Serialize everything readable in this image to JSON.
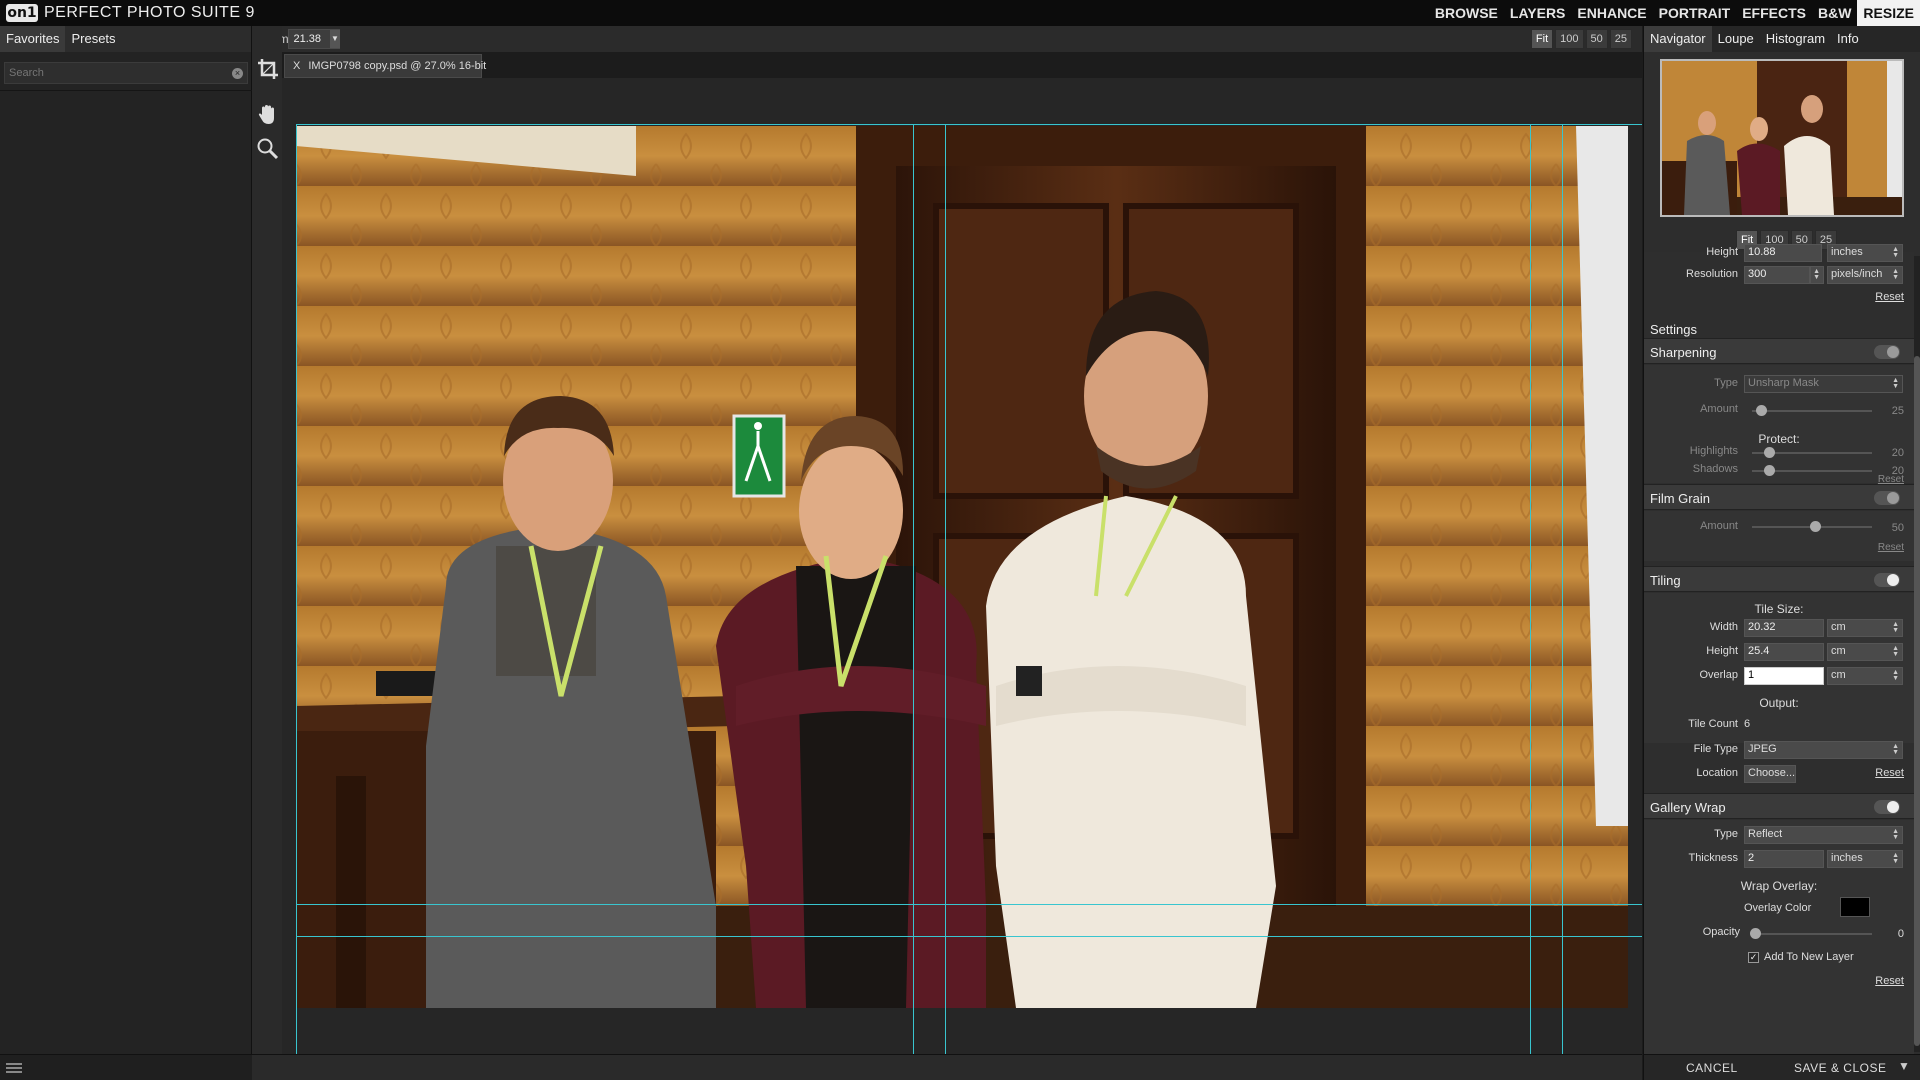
{
  "app": {
    "logo": "on1",
    "title": "PERFECT PHOTO SUITE 9"
  },
  "modules": [
    {
      "label": "BROWSE",
      "active": false
    },
    {
      "label": "LAYERS",
      "active": false
    },
    {
      "label": "ENHANCE",
      "active": false
    },
    {
      "label": "PORTRAIT",
      "active": false
    },
    {
      "label": "EFFECTS",
      "active": false
    },
    {
      "label": "B&W",
      "active": false
    },
    {
      "label": "RESIZE",
      "active": true
    }
  ],
  "left": {
    "tabs": [
      "Favorites",
      "Presets"
    ],
    "search_placeholder": "Search"
  },
  "zoom": {
    "label": "Zoom",
    "value": "21.38",
    "buttons": [
      "Fit",
      "100",
      "50",
      "25"
    ]
  },
  "file_tab": {
    "close": "X",
    "name": "IMGP0798 copy.psd @ 27.0% 16-bit"
  },
  "right": {
    "tabs": [
      "Navigator",
      "Loupe",
      "Histogram",
      "Info"
    ],
    "nav_buttons": [
      "Fit",
      "100",
      "50",
      "25"
    ],
    "height": {
      "label": "Height",
      "value": "10.88",
      "unit": "inches"
    },
    "resolution": {
      "label": "Resolution",
      "value": "300",
      "unit": "pixels/inch"
    },
    "reset": "Reset",
    "settings_label": "Settings",
    "sharpening": {
      "title": "Sharpening",
      "enabled": false,
      "type_label": "Type",
      "type_value": "Unsharp Mask",
      "amount_label": "Amount",
      "amount_value": "25",
      "protect_label": "Protect:",
      "highlights_label": "Highlights",
      "highlights_value": "20",
      "shadows_label": "Shadows",
      "shadows_value": "20"
    },
    "film_grain": {
      "title": "Film Grain",
      "enabled": false,
      "amount_label": "Amount",
      "amount_value": "50"
    },
    "tiling": {
      "title": "Tiling",
      "enabled": true,
      "tile_size_label": "Tile Size:",
      "width_label": "Width",
      "width_value": "20.32",
      "width_unit": "cm",
      "height_label": "Height",
      "height_value": "25.4",
      "height_unit": "cm",
      "overlap_label": "Overlap",
      "overlap_value": "1",
      "overlap_unit": "cm",
      "output_label": "Output:",
      "tile_count_label": "Tile Count",
      "tile_count_value": "6",
      "file_type_label": "File Type",
      "file_type_value": "JPEG",
      "location_label": "Location",
      "location_button": "Choose..."
    },
    "gallery_wrap": {
      "title": "Gallery Wrap",
      "enabled": true,
      "type_label": "Type",
      "type_value": "Reflect",
      "thickness_label": "Thickness",
      "thickness_value": "2",
      "thickness_unit": "inches",
      "wrap_overlay_label": "Wrap Overlay:",
      "overlay_color_label": "Overlay Color",
      "overlay_color": "#000000",
      "opacity_label": "Opacity",
      "opacity_value": "0",
      "add_layer_label": "Add To New Layer",
      "add_layer_checked": true
    },
    "cancel": "CANCEL",
    "save_close": "SAVE & CLOSE"
  },
  "colors": {
    "guide": "#39c5cf",
    "wall": "#c58a3a",
    "door": "#4a2712"
  }
}
